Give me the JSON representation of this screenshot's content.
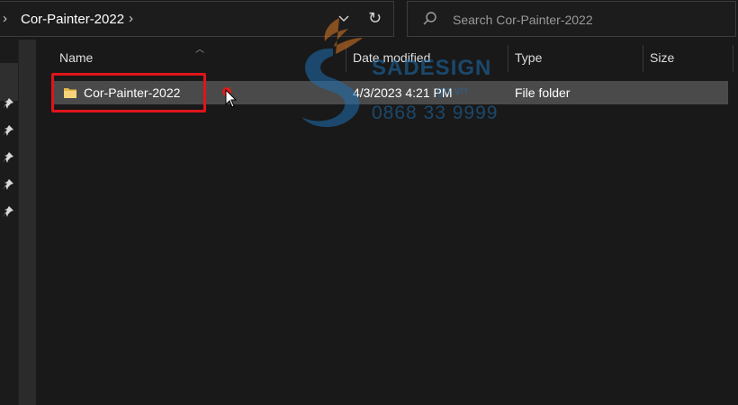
{
  "address_bar": {
    "current_folder": "Cor-Painter-2022"
  },
  "search": {
    "placeholder": "Search Cor-Painter-2022"
  },
  "columns": {
    "name": "Name",
    "date_modified": "Date modified",
    "type": "Type",
    "size": "Size"
  },
  "rows": [
    {
      "name": "Cor-Painter-2022",
      "date_modified": "4/3/2023 4:21 PM",
      "type": "File folder",
      "size": ""
    }
  ],
  "watermark": {
    "brand": "SADESIGN",
    "site": "gn.vn",
    "phone": "0868 33 9999"
  },
  "colors": {
    "background": "#191919",
    "selected_row": "#4a4a4a",
    "highlight_box": "#e0141b",
    "watermark_blue": "#1e6fb0",
    "watermark_orange": "#e07b24"
  }
}
